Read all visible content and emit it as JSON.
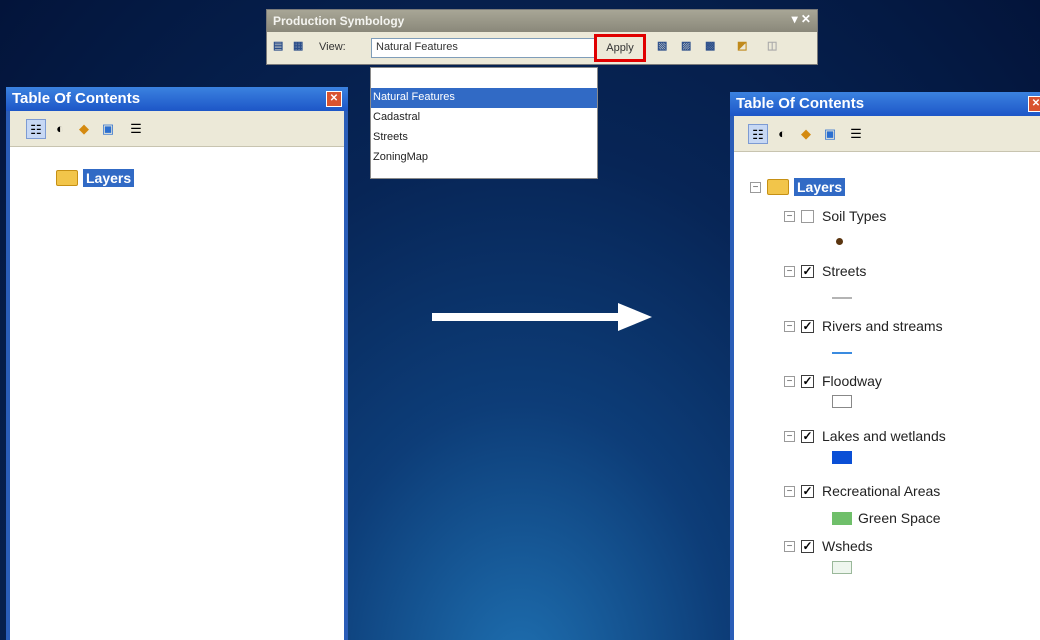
{
  "toolbar": {
    "title": "Production Symbology",
    "controls": "▾ ✕",
    "view_label": "View:",
    "view_value": "Natural Features",
    "apply_label": "Apply"
  },
  "dropdown": {
    "options": [
      "",
      "Natural Features",
      "Cadastral",
      "Streets",
      "ZoningMap"
    ],
    "selected": "Natural Features"
  },
  "toc_left": {
    "title": "Table Of Contents",
    "root_label": "Layers"
  },
  "toc_right": {
    "title": "Table Of Contents",
    "root_label": "Layers",
    "layers": [
      {
        "label": "Soil Types",
        "checked": false
      },
      {
        "label": "Streets",
        "checked": true
      },
      {
        "label": "Rivers and streams",
        "checked": true
      },
      {
        "label": "Floodway",
        "checked": true
      },
      {
        "label": "Lakes and wetlands",
        "checked": true
      },
      {
        "label": "Recreational Areas",
        "checked": true,
        "legend": "Green Space"
      },
      {
        "label": "Wsheds",
        "checked": true
      }
    ]
  },
  "colors": {
    "accent": "#316ac5",
    "apply_highlight": "#e00000",
    "lake_fill": "#0a4fd6",
    "green_space": "#6fbf6a",
    "river_line": "#3a8be0"
  }
}
